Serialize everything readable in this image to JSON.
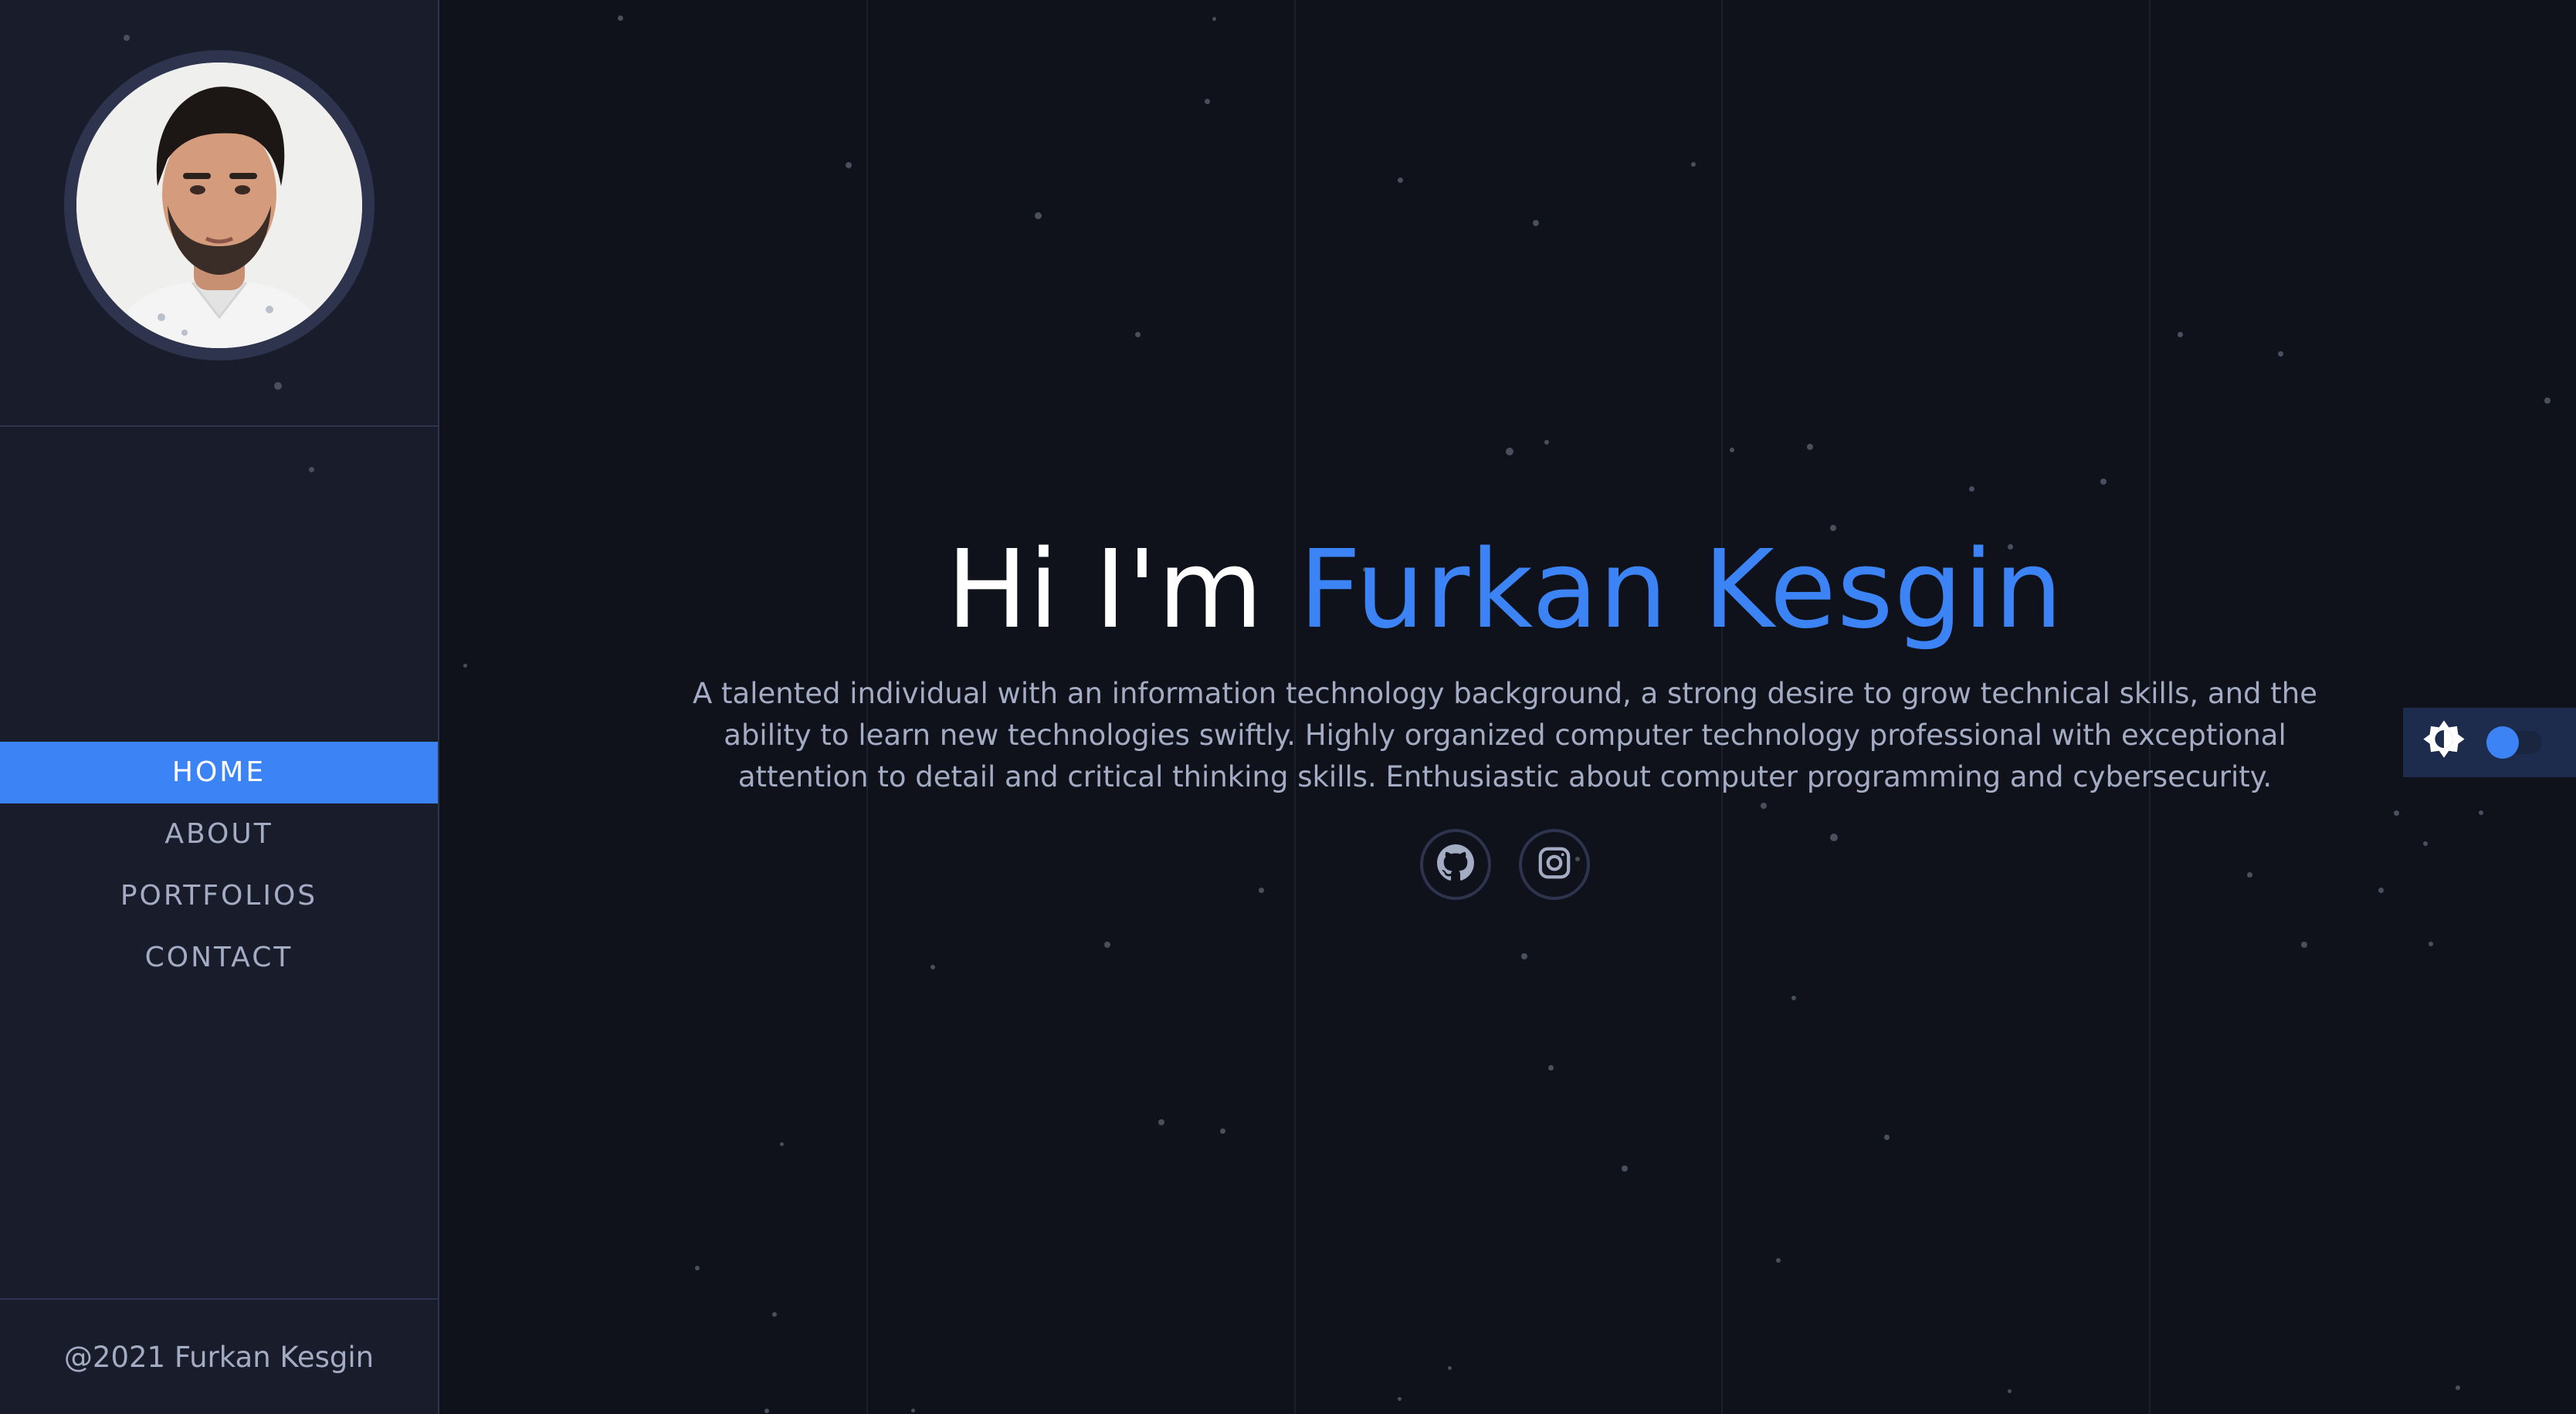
{
  "sidebar": {
    "avatar_alt": "Furkan Kesgin",
    "nav": [
      {
        "label": "HOME",
        "active": true
      },
      {
        "label": "ABOUT",
        "active": false
      },
      {
        "label": "PORTFOLIOS",
        "active": false
      },
      {
        "label": "CONTACT",
        "active": false
      }
    ],
    "footer": "@2021 Furkan Kesgin"
  },
  "hero": {
    "greeting": "Hi I'm ",
    "name": "Furkan Kesgin",
    "description": "A talented individual with an information technology background, a strong desire to grow technical skills, and the ability to learn new technologies swiftly. Highly organized computer technology professional with exceptional attention to detail and critical thinking skills. Enthusiastic about computer programming and cybersecurity.",
    "socials": [
      {
        "icon": "github-icon"
      },
      {
        "icon": "instagram-icon"
      }
    ]
  },
  "theme_toggle": {
    "icon": "brightness-icon",
    "state": "dark"
  },
  "colors": {
    "accent": "#3c83f6",
    "background": "#10121b",
    "sidebar": "#191d2b",
    "border": "#2e344e",
    "text": "#a4acc4"
  }
}
